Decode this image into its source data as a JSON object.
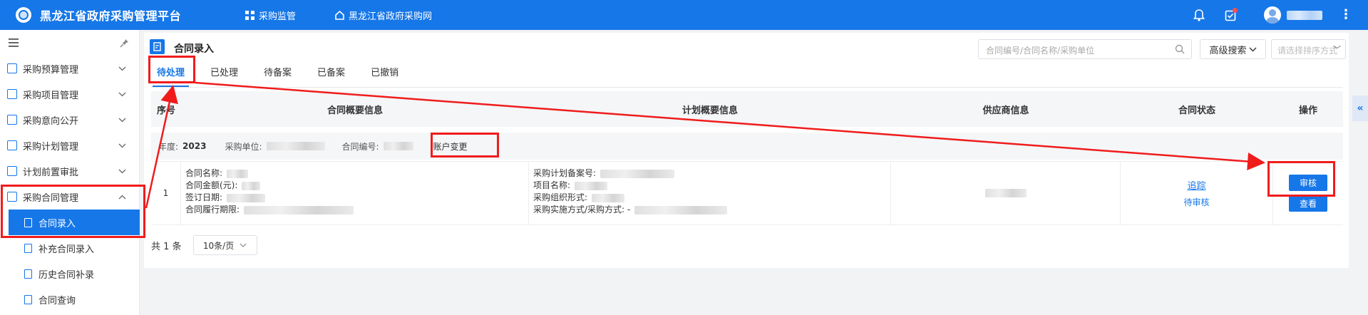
{
  "topbar": {
    "app_title": "黑龙江省政府采购管理平台",
    "nav": [
      {
        "label": "采购监管",
        "icon": "grid-icon"
      },
      {
        "label": "黑龙江省政府采购网",
        "icon": "home-icon"
      }
    ],
    "icons": [
      "bell-icon",
      "checklist-icon",
      "user-avatar-icon",
      "more-icon"
    ],
    "brand_color": "#1677e8"
  },
  "sidebar": {
    "menu": [
      {
        "label": "采购预算管理",
        "expanded": false
      },
      {
        "label": "采购项目管理",
        "expanded": false
      },
      {
        "label": "采购意向公开",
        "expanded": false
      },
      {
        "label": "采购计划管理",
        "expanded": false
      },
      {
        "label": "计划前置审批",
        "expanded": false
      },
      {
        "label": "采购合同管理",
        "expanded": true
      }
    ],
    "sub_items": [
      {
        "label": "合同录入",
        "active": true
      },
      {
        "label": "补充合同录入",
        "active": false
      },
      {
        "label": "历史合同补录",
        "active": false
      },
      {
        "label": "合同查询",
        "active": false
      }
    ]
  },
  "page": {
    "title": "合同录入",
    "search_placeholder": "合同编号/合同名称/采购单位",
    "advanced_search": "高级搜索",
    "sort_placeholder": "请选择排序方式",
    "tabs": [
      "待处理",
      "已处理",
      "待备案",
      "已备案",
      "已撤销"
    ],
    "active_tab": 0
  },
  "table": {
    "headers": [
      "序号",
      "合同概要信息",
      "计划概要信息",
      "供应商信息",
      "合同状态",
      "操作"
    ],
    "group": {
      "year_label": "年度:",
      "year": "2023",
      "unit_label": "采购单位:",
      "contract_no_label": "合同编号:",
      "tag": "账户变更"
    },
    "row": {
      "index": "1",
      "contract_fields": [
        "合同名称:",
        "合同金额(元):",
        "签订日期:",
        "合同履行期限:"
      ],
      "plan_fields": [
        "采购计划备案号:",
        "项目名称:",
        "采购组织形式:",
        "采购实施方式/采购方式: -"
      ],
      "status_link": "追踪",
      "status_text": "待审核",
      "actions": [
        "审核",
        "查看"
      ]
    }
  },
  "footer": {
    "total": "共 1 条",
    "page_size": "10条/页"
  },
  "annotation_color": "#f01c1c"
}
